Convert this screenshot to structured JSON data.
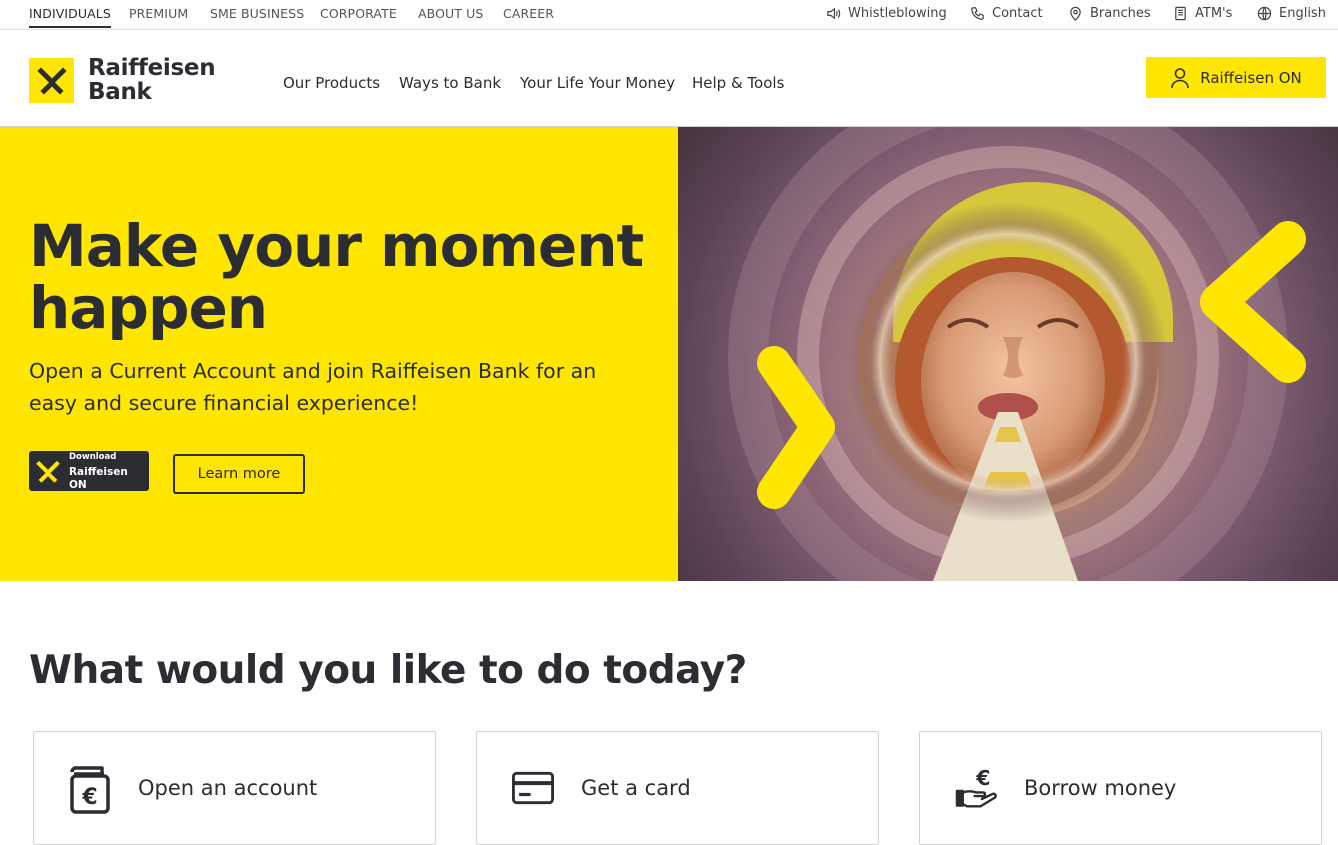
{
  "topbar": {
    "segments": [
      "INDIVIDUALS",
      "PREMIUM",
      "SME BUSINESS",
      "CORPORATE",
      "ABOUT US",
      "CAREER"
    ],
    "active_segment": "INDIVIDUALS",
    "utilities": [
      {
        "label": "Whistleblowing",
        "icon": "megaphone-icon"
      },
      {
        "label": "Contact",
        "icon": "phone-icon"
      },
      {
        "label": "Branches",
        "icon": "location-pin-icon"
      },
      {
        "label": "ATM's",
        "icon": "atm-icon"
      },
      {
        "label": "English",
        "icon": "globe-icon"
      }
    ]
  },
  "header": {
    "logo_line1": "Raiffeisen",
    "logo_line2": "Bank",
    "nav": [
      "Our Products",
      "Ways to Bank",
      "Your Life Your Money",
      "Help & Tools"
    ],
    "cta_label": "Raiffeisen ON"
  },
  "hero": {
    "title": "Make your moment happen",
    "subtitle": "Open a Current Account and join Raiffeisen Bank for an easy and secure financial experience!",
    "download_small": "Download",
    "download_big": "Raiffeisen ON",
    "learn_more": "Learn more"
  },
  "actions": {
    "title": "What would you like to do today?",
    "cards": [
      {
        "label": "Open an account",
        "icon": "wallet-euro-icon"
      },
      {
        "label": "Get a card",
        "icon": "credit-card-icon"
      },
      {
        "label": "Borrow money",
        "icon": "hand-euro-icon"
      }
    ]
  },
  "colors": {
    "brand_yellow": "#fee600",
    "text_dark": "#2b2d33"
  }
}
